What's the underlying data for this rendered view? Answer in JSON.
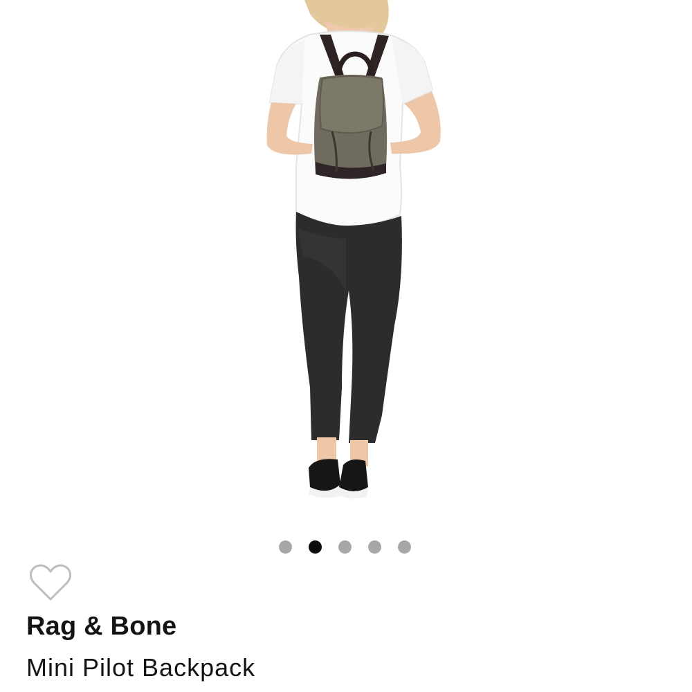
{
  "product": {
    "brand": "Rag & Bone",
    "name": "Mini Pilot Backpack"
  },
  "carousel": {
    "total_images": 5,
    "active_index": 2
  },
  "icons": {
    "wishlist": "heart-outline-icon"
  },
  "colors": {
    "dot_inactive": "#a7a7a7",
    "dot_active": "#0d0d0d",
    "text": "#141414"
  }
}
